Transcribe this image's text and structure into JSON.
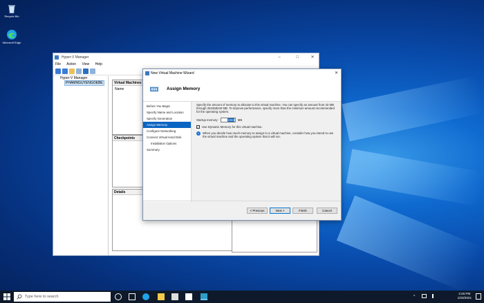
{
  "desktop": {
    "icons": [
      {
        "label": "Recycle Bin",
        "icon": "recycle-bin-icon"
      },
      {
        "label": "Microsoft Edge",
        "icon": "edge-icon"
      }
    ]
  },
  "hyperv": {
    "title": "Hyper-V Manager",
    "menu": [
      "File",
      "Action",
      "View",
      "Help"
    ],
    "tree": {
      "root": "Hyper-V Manager",
      "server": "PHAMNGUYENGOEBE"
    },
    "panes": {
      "vms": "Virtual Machines",
      "vms_col": "Name",
      "checkpoints": "Checkpoints",
      "details": "Details"
    }
  },
  "wizard": {
    "title": "New Virtual Machine Wizard",
    "header": "Assign Memory",
    "steps": [
      "Before You Begin",
      "Specify Name and Location",
      "Specify Generation",
      "Assign Memory",
      "Configure Networking",
      "Connect Virtual Hard Disk",
      "Installation Options",
      "Summary"
    ],
    "active_step": "Assign Memory",
    "description": "Specify the amount of memory to allocate to this virtual machine. You can specify an amount from 32 MB through 251658240 MB. To improve performance, specify more than the minimum amount recommended for the operating system.",
    "startup_label": "Startup memory:",
    "startup_value": "1024",
    "startup_unit": "MB",
    "dynamic_label": "Use Dynamic Memory for this virtual machine.",
    "dynamic_checked": true,
    "info_text": "When you decide how much memory to assign to a virtual machine, consider how you intend to use the virtual machine and the operating system that it will run.",
    "buttons": {
      "previous": "< Previous",
      "next": "Next >",
      "finish": "Finish",
      "cancel": "Cancel"
    }
  },
  "taskbar": {
    "search_placeholder": "Type here to search",
    "time": "2:26 PM",
    "date": "1/20/2021"
  },
  "colors": {
    "accent": "#0a64c2",
    "taskbar": "#0e1a2b"
  }
}
